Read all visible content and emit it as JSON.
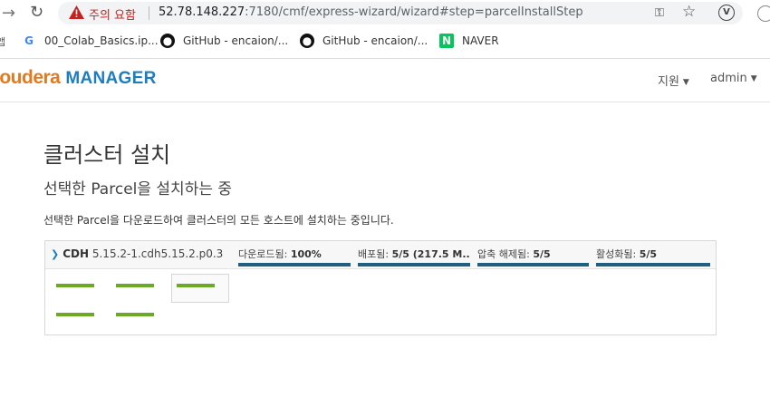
{
  "browser": {
    "security_warning": "주의 요함",
    "url_host": "52.78.148.227",
    "url_rest": ":7180/cmf/express-wizard/wizard#step=parcelInstallStep",
    "ext_letter": "V",
    "bookmarks": [
      {
        "label": "00_Colab_Basics.ip...",
        "icon": "google-icon"
      },
      {
        "label": "GitHub - encaion/...",
        "icon": "github-icon"
      },
      {
        "label": "GitHub - encaion/...",
        "icon": "github-icon"
      },
      {
        "label": "NAVER",
        "icon": "naver-icon"
      }
    ],
    "apps_label": "앱"
  },
  "header": {
    "brand_left": "loudera",
    "brand_right": "MANAGER",
    "support_label": "지원",
    "user_label": "admin"
  },
  "main": {
    "title": "클러스터 설치",
    "subtitle": "선택한 Parcel을 설치하는 중",
    "description": "선택한 Parcel을 다운로드하여 클러스터의 모든 호스트에 설치하는 중입니다."
  },
  "parcel": {
    "name": "CDH",
    "version": "5.15.2-1.cdh5.15.2.p0.3",
    "stages": [
      {
        "label": "다운로드됨:",
        "value": "100%",
        "progress": 1.0
      },
      {
        "label": "배포됨:",
        "value": "5/5 (217.5 M...",
        "progress": 1.0
      },
      {
        "label": "압축 해제됨:",
        "value": "5/5",
        "progress": 1.0
      },
      {
        "label": "활성화됨:",
        "value": "5/5",
        "progress": 1.0
      }
    ],
    "host_count": 5
  },
  "colors": {
    "brand_orange": "#e37a1f",
    "brand_blue": "#1c7ec1",
    "progress_fill": "#1f5f7f",
    "host_ok": "#6aaa27"
  }
}
